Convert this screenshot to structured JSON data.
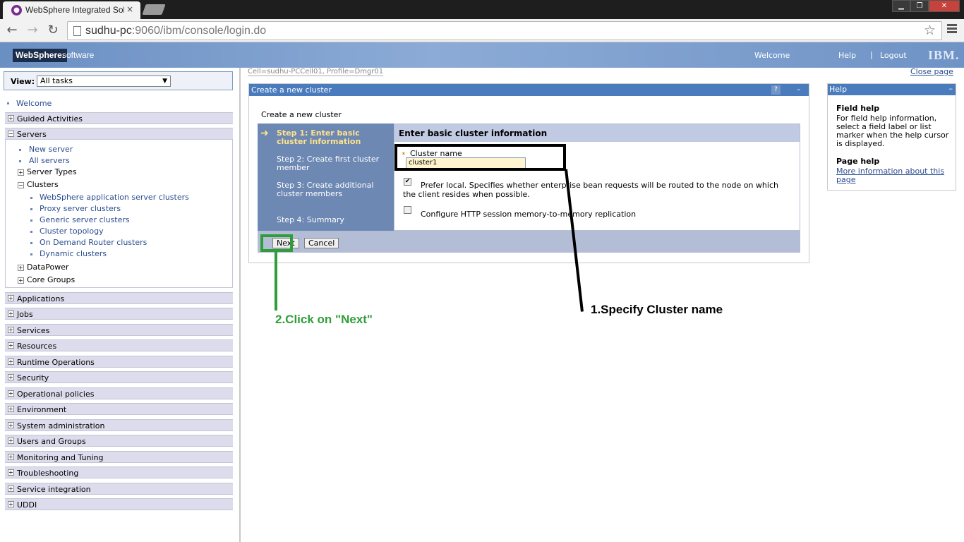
{
  "browser": {
    "tab_title": "WebSphere Integrated Sol",
    "tab_close": "×",
    "url_host": "sudhu-pc",
    "url_rest": ":9060/ibm/console/login.do",
    "win_min": "▁",
    "win_max": "❐",
    "win_close": "✕"
  },
  "header": {
    "logo": "WebSphere.",
    "software": "software",
    "welcome": "Welcome",
    "help": "Help",
    "separator": "|",
    "logout": "Logout",
    "ibm": "IBM."
  },
  "nav": {
    "view_label": "View:",
    "view_value": "All tasks",
    "welcome": "Welcome",
    "guided": "Guided Activities",
    "servers": "Servers",
    "new_server": "New server",
    "all_servers": "All servers",
    "server_types": "Server Types",
    "clusters": "Clusters",
    "cluster_links": [
      "WebSphere application server clusters",
      "Proxy server clusters",
      "Generic server clusters",
      "Cluster topology",
      "On Demand Router clusters",
      "Dynamic clusters"
    ],
    "datapower": "DataPower",
    "core_groups": "Core Groups",
    "groups": [
      "Applications",
      "Jobs",
      "Services",
      "Resources",
      "Runtime Operations",
      "Security",
      "Operational policies",
      "Environment",
      "System administration",
      "Users and Groups",
      "Monitoring and Tuning",
      "Troubleshooting",
      "Service integration",
      "UDDI"
    ]
  },
  "main": {
    "breadcrumb": "Cell=sudhu-PCCell01, Profile=Dmgr01",
    "close_page": "Close page",
    "wizard_title": "Create a new cluster",
    "wizard_help": "?",
    "wizard_min": "–",
    "wizard_subtitle": "Create a new cluster",
    "steps": [
      "Step 1: Enter basic cluster information",
      "Step 2: Create first cluster member",
      "Step 3: Create additional cluster members",
      "Step 4: Summary"
    ],
    "content_header": "Enter basic cluster information",
    "required_marker": "*",
    "cluster_label": "Cluster name",
    "cluster_value": "cluster1",
    "prefer_local": "Prefer local. Specifies whether enterprise bean requests will be routed to the node on which the client resides when possible.",
    "prefer_local_checked": true,
    "http_replication": "Configure HTTP session memory-to-memory replication",
    "http_replication_checked": false,
    "next": "Next",
    "cancel": "Cancel"
  },
  "help": {
    "title": "Help",
    "min": "–",
    "field_help_title": "Field help",
    "field_help_text": "For field help information, select a field label or list marker when the help cursor is displayed.",
    "page_help_title": "Page help",
    "page_help_link": "More information about this page"
  },
  "annotations": {
    "step1": "1.Specify Cluster name",
    "step2": "2.Click on \"Next\""
  }
}
